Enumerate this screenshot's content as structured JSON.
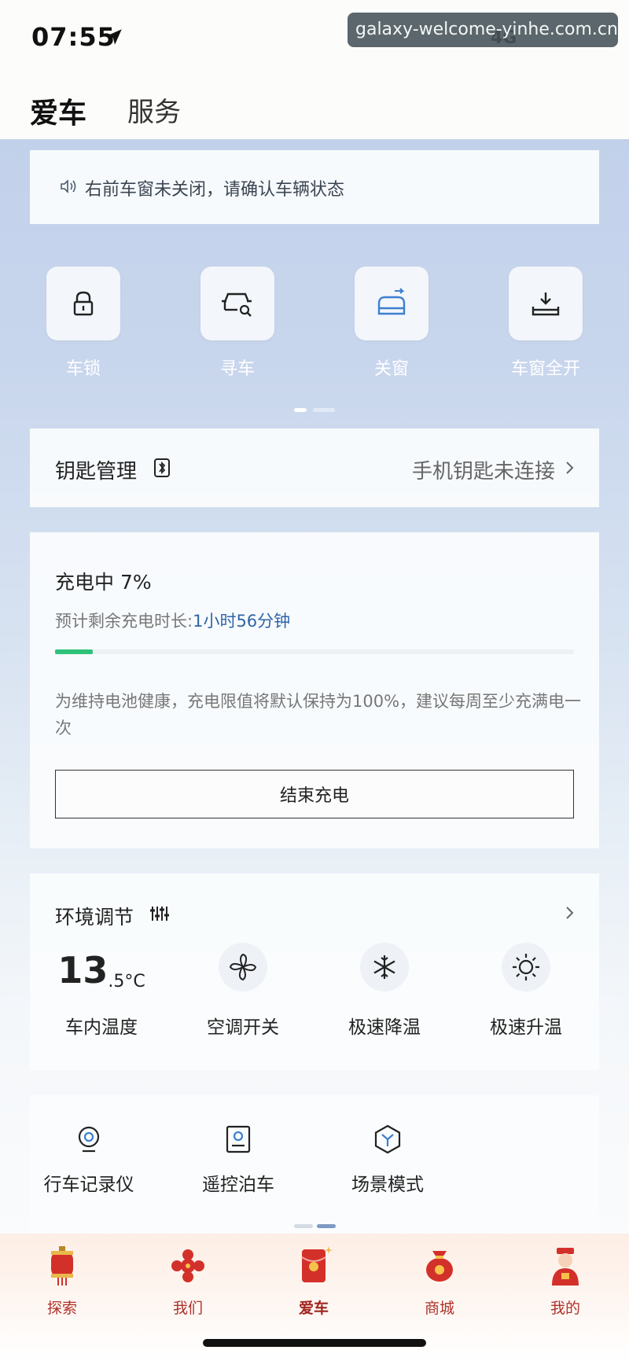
{
  "status_bar": {
    "time": "07:55",
    "signal_text": "4G",
    "watermark": "galaxy-welcome-yinhe.com.cn"
  },
  "header": {
    "tabs": [
      {
        "label": "爱车",
        "active": true
      },
      {
        "label": "服务",
        "active": false
      }
    ]
  },
  "notice": {
    "icon": "speaker-icon",
    "text": "右前车窗未关闭，请确认车辆状态"
  },
  "controls": [
    {
      "label": "车锁",
      "icon": "lock-icon"
    },
    {
      "label": "寻车",
      "icon": "find-car-icon"
    },
    {
      "label": "关窗",
      "icon": "close-window-icon"
    },
    {
      "label": "车窗全开",
      "icon": "open-window-icon"
    }
  ],
  "key": {
    "title": "钥匙管理",
    "status": "手机钥匙未连接"
  },
  "charging": {
    "title": "充电中 7%",
    "remain_label": "预计剩余充电时长:",
    "remain_value": "1小时56分钟",
    "progress_fraction": 0.07,
    "tip": "为维持电池健康，充电限值将默认保持为100%，建议每周至少充满电一次",
    "end_button": "结束充电"
  },
  "environment": {
    "title": "环境调节",
    "temp_int": "13",
    "temp_dec": ".5°C",
    "items": [
      {
        "label": "车内温度"
      },
      {
        "label": "空调开关",
        "icon": "fan-icon"
      },
      {
        "label": "极速降温",
        "icon": "snowflake-icon"
      },
      {
        "label": "极速升温",
        "icon": "sun-icon"
      }
    ]
  },
  "functions": [
    {
      "label": "行车记录仪",
      "icon": "dashcam-icon"
    },
    {
      "label": "遥控泊车",
      "icon": "remote-parking-icon"
    },
    {
      "label": "场景模式",
      "icon": "scene-mode-icon"
    }
  ],
  "bottom_nav": [
    {
      "label": "探索",
      "icon": "lantern-icon"
    },
    {
      "label": "我们",
      "icon": "chinese-knot-icon"
    },
    {
      "label": "爱车",
      "icon": "red-envelope-icon",
      "active": true
    },
    {
      "label": "商城",
      "icon": "money-bag-icon"
    },
    {
      "label": "我的",
      "icon": "fortune-god-icon"
    }
  ],
  "colors": {
    "charge_green": "#2fc27a",
    "link_blue": "#2f64a8",
    "nav_red": "#b0312b"
  }
}
